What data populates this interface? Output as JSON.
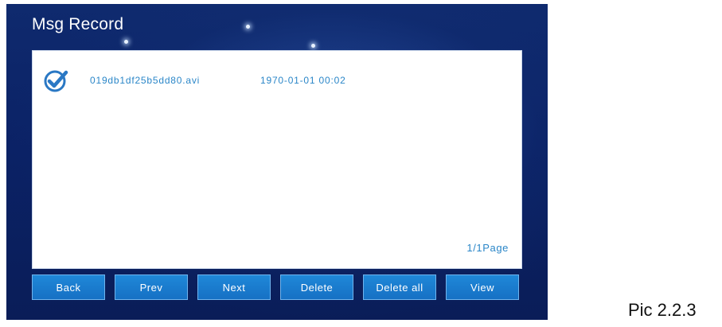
{
  "app": {
    "title": "Msg Record"
  },
  "records": [
    {
      "selected": true,
      "file_name": "019db1df25b5dd80.avi",
      "date": "1970-01-01  00:02"
    }
  ],
  "pagination": {
    "label": "1/1Page"
  },
  "toolbar": {
    "back_label": "Back",
    "prev_label": "Prev",
    "next_label": "Next",
    "delete_label": "Delete",
    "delete_all_label": "Delete all",
    "view_label": "View"
  },
  "caption": "Pic 2.2.3",
  "colors": {
    "background": "#0b2266",
    "button": "#1a7ccf",
    "accent_text": "#2a86c8"
  },
  "icons": {
    "check": "checkmark-circle-icon"
  }
}
